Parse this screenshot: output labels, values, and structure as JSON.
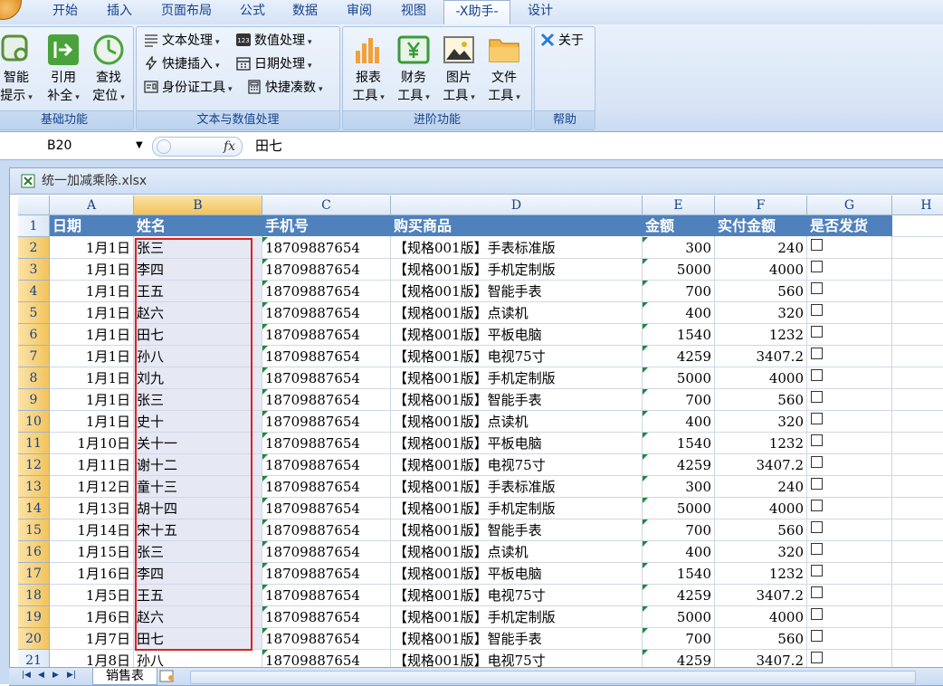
{
  "ribbon_tabs": [
    "开始",
    "插入",
    "页面布局",
    "公式",
    "数据",
    "审阅",
    "视图",
    "-X助手-",
    "设计"
  ],
  "active_tab": "-X助手-",
  "groups": {
    "basic": {
      "label": "基础功能",
      "buttons": [
        {
          "line1": "智能",
          "line2": "提示"
        },
        {
          "line1": "引用",
          "line2": "补全"
        },
        {
          "line1": "查找",
          "line2": "定位"
        }
      ]
    },
    "text": {
      "label": "文本与数值处理",
      "items": [
        "文本处理",
        "数值处理",
        "快捷插入",
        "日期处理",
        "身份证工具",
        "快捷凑数"
      ]
    },
    "advanced": {
      "label": "进阶功能",
      "buttons": [
        {
          "line1": "报表",
          "line2": "工具"
        },
        {
          "line1": "财务",
          "line2": "工具"
        },
        {
          "line1": "图片",
          "line2": "工具"
        },
        {
          "line1": "文件",
          "line2": "工具"
        }
      ]
    },
    "help": {
      "label": "帮助",
      "about": "关于"
    }
  },
  "formula_bar": {
    "cell_ref": "B20",
    "fx": "fx",
    "value": "田七"
  },
  "workbook": {
    "title": "统一加减乘除.xlsx"
  },
  "columns": [
    "A",
    "B",
    "C",
    "D",
    "E",
    "F",
    "G",
    "H"
  ],
  "selected_column": "B",
  "header_row": [
    "日期",
    "姓名",
    "手机号",
    "购买商品",
    "金额",
    "实付金额",
    "是否发货"
  ],
  "rows": [
    {
      "n": "2",
      "date": "1月1日",
      "name": "张三",
      "phone": "18709887654",
      "product": "【规格001版】手表标准版",
      "amount": "300",
      "paid": "240"
    },
    {
      "n": "3",
      "date": "1月1日",
      "name": "李四",
      "phone": "18709887654",
      "product": "【规格001版】手机定制版",
      "amount": "5000",
      "paid": "4000"
    },
    {
      "n": "4",
      "date": "1月1日",
      "name": "王五",
      "phone": "18709887654",
      "product": "【规格001版】智能手表",
      "amount": "700",
      "paid": "560"
    },
    {
      "n": "5",
      "date": "1月1日",
      "name": "赵六",
      "phone": "18709887654",
      "product": "【规格001版】点读机",
      "amount": "400",
      "paid": "320"
    },
    {
      "n": "6",
      "date": "1月1日",
      "name": "田七",
      "phone": "18709887654",
      "product": "【规格001版】平板电脑",
      "amount": "1540",
      "paid": "1232"
    },
    {
      "n": "7",
      "date": "1月1日",
      "name": "孙八",
      "phone": "18709887654",
      "product": "【规格001版】电视75寸",
      "amount": "4259",
      "paid": "3407.2"
    },
    {
      "n": "8",
      "date": "1月1日",
      "name": "刘九",
      "phone": "18709887654",
      "product": "【规格001版】手机定制版",
      "amount": "5000",
      "paid": "4000"
    },
    {
      "n": "9",
      "date": "1月1日",
      "name": "张三",
      "phone": "18709887654",
      "product": "【规格001版】智能手表",
      "amount": "700",
      "paid": "560"
    },
    {
      "n": "10",
      "date": "1月1日",
      "name": "史十",
      "phone": "18709887654",
      "product": "【规格001版】点读机",
      "amount": "400",
      "paid": "320"
    },
    {
      "n": "11",
      "date": "1月10日",
      "name": "关十一",
      "phone": "18709887654",
      "product": "【规格001版】平板电脑",
      "amount": "1540",
      "paid": "1232"
    },
    {
      "n": "12",
      "date": "1月11日",
      "name": "谢十二",
      "phone": "18709887654",
      "product": "【规格001版】电视75寸",
      "amount": "4259",
      "paid": "3407.2"
    },
    {
      "n": "13",
      "date": "1月12日",
      "name": "童十三",
      "phone": "18709887654",
      "product": "【规格001版】手表标准版",
      "amount": "300",
      "paid": "240"
    },
    {
      "n": "14",
      "date": "1月13日",
      "name": "胡十四",
      "phone": "18709887654",
      "product": "【规格001版】手机定制版",
      "amount": "5000",
      "paid": "4000"
    },
    {
      "n": "15",
      "date": "1月14日",
      "name": "宋十五",
      "phone": "18709887654",
      "product": "【规格001版】智能手表",
      "amount": "700",
      "paid": "560"
    },
    {
      "n": "16",
      "date": "1月15日",
      "name": "张三",
      "phone": "18709887654",
      "product": "【规格001版】点读机",
      "amount": "400",
      "paid": "320"
    },
    {
      "n": "17",
      "date": "1月16日",
      "name": "李四",
      "phone": "18709887654",
      "product": "【规格001版】平板电脑",
      "amount": "1540",
      "paid": "1232"
    },
    {
      "n": "18",
      "date": "1月5日",
      "name": "王五",
      "phone": "18709887654",
      "product": "【规格001版】电视75寸",
      "amount": "4259",
      "paid": "3407.2"
    },
    {
      "n": "19",
      "date": "1月6日",
      "name": "赵六",
      "phone": "18709887654",
      "product": "【规格001版】手机定制版",
      "amount": "5000",
      "paid": "4000"
    },
    {
      "n": "20",
      "date": "1月7日",
      "name": "田七",
      "phone": "18709887654",
      "product": "【规格001版】智能手表",
      "amount": "700",
      "paid": "560"
    },
    {
      "n": "21",
      "date": "1月8日",
      "name": "孙八",
      "phone": "18709887654",
      "product": "【规格001版】电视75寸",
      "amount": "4259",
      "paid": "3407.2"
    }
  ],
  "sheet_tab": "销售表",
  "colors": {
    "header_fill": "#4f81bd",
    "selection_border": "#e02020",
    "ribbon_text": "#15428b"
  }
}
